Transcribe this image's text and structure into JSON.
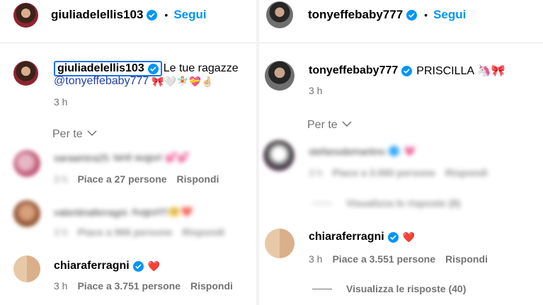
{
  "left": {
    "header": {
      "username": "giulia​delellis103",
      "dot": "•",
      "follow": "Segui"
    },
    "post": {
      "username": "giuliadelellis103",
      "text": "Le tue ragazze",
      "mention": "@tonyeffebaby777",
      "emojis": "🎀🤍🧚🏻💝🤞🏻",
      "time": "3 h"
    },
    "sort_label": "Per te",
    "comments": [
      {
        "username": "saraamira25",
        "text": "tanti auguri 💕💕",
        "time": "3 h",
        "likes": "Piace a 27 persone",
        "reply": "Rispondi",
        "blurred": true
      },
      {
        "username": "valentinaferragni",
        "text": "Auguri!!!🤗❤️",
        "time": "3 h",
        "likes": "Piace a 966 persone",
        "reply": "Rispondi",
        "blurred": true
      },
      {
        "username": "chiaraferragni",
        "text": "❤️",
        "time": "3 h",
        "likes": "Piace a 3.751 persone",
        "reply": "Rispondi",
        "blurred": false
      }
    ]
  },
  "right": {
    "header": {
      "username": "tonyeffebaby777",
      "dot": "•",
      "follow": "Segui"
    },
    "post": {
      "username": "tonyeffebaby777",
      "text": "PRISCILLA 🦄🎀",
      "time": "3 h"
    },
    "sort_label": "Per te",
    "comments": [
      {
        "username": "stefanodemartino",
        "text": "💗",
        "time": "3 h",
        "likes": "Piace a 3.060 persone",
        "reply": "Rispondi",
        "replies": "Visualizza le risposte (8)",
        "blurred": true
      },
      {
        "username": "chiaraferragni",
        "text": "❤️",
        "time": "3 h",
        "likes": "Piace a 3.551 persone",
        "reply": "Rispondi",
        "replies": "Visualizza le risposte (40)",
        "blurred": false
      }
    ]
  },
  "colors": {
    "follow": "#0095f6",
    "verified": "#0095f6",
    "mention": "#1f3fa8",
    "meta": "#737373",
    "focus": "#1a73e8"
  }
}
